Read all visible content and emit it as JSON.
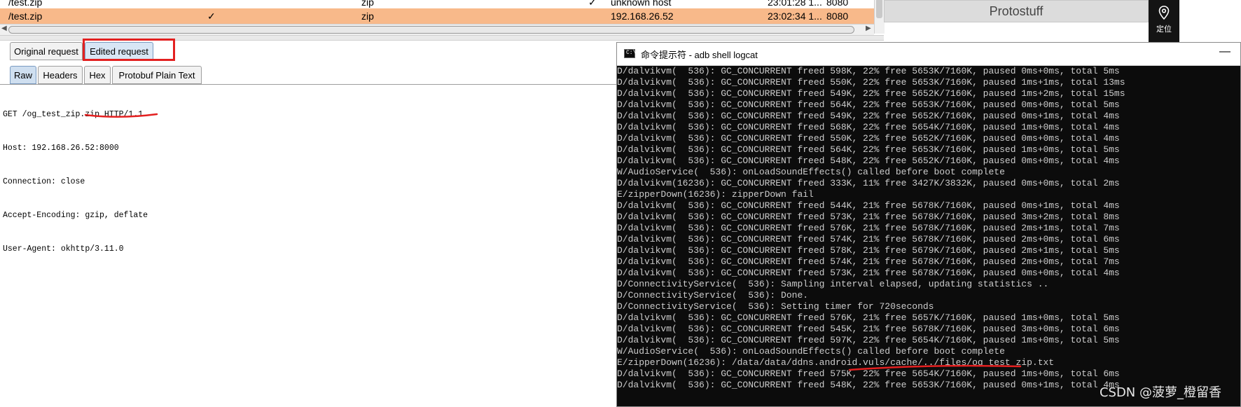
{
  "history": {
    "rows": [
      {
        "path": "/test.zip",
        "check": "",
        "ext": "zip",
        "edited": "✓",
        "ip": "unknown host",
        "time": "23:01:28 1...",
        "port": "8080"
      },
      {
        "path": "/test.zip",
        "check": "✓",
        "ext": "zip",
        "edited": "",
        "ip": "192.168.26.52",
        "time": "23:02:34 1...",
        "port": "8080"
      }
    ]
  },
  "request_tabs": {
    "original": "Original request",
    "edited": "Edited request"
  },
  "view_tabs": {
    "raw": "Raw",
    "headers": "Headers",
    "hex": "Hex",
    "protobuf": "Protobuf Plain Text"
  },
  "request_lines": [
    "GET /og_test_zip.zip HTTP/1.1",
    "Host: 192.168.26.52:8000",
    "Connection: close",
    "Accept-Encoding: gzip, deflate",
    "User-Agent: okhttp/3.11.0"
  ],
  "side_panel": {
    "protostuff_label": "Protostuff",
    "locate_label": "定位"
  },
  "cmd": {
    "title": "命令提示符 - adb  shell logcat",
    "icon_text": "C:\\",
    "minimize": "—",
    "lines": [
      "D/dalvikvm(  536): GC_CONCURRENT freed 598K, 22% free 5653K/7160K, paused 0ms+0ms, total 5ms",
      "D/dalvikvm(  536): GC_CONCURRENT freed 550K, 22% free 5653K/7160K, paused 1ms+1ms, total 13ms",
      "D/dalvikvm(  536): GC_CONCURRENT freed 549K, 22% free 5652K/7160K, paused 1ms+2ms, total 15ms",
      "D/dalvikvm(  536): GC_CONCURRENT freed 564K, 22% free 5653K/7160K, paused 0ms+0ms, total 5ms",
      "D/dalvikvm(  536): GC_CONCURRENT freed 549K, 22% free 5652K/7160K, paused 0ms+1ms, total 4ms",
      "D/dalvikvm(  536): GC_CONCURRENT freed 568K, 22% free 5654K/7160K, paused 1ms+0ms, total 4ms",
      "D/dalvikvm(  536): GC_CONCURRENT freed 550K, 22% free 5652K/7160K, paused 0ms+0ms, total 4ms",
      "D/dalvikvm(  536): GC_CONCURRENT freed 564K, 22% free 5653K/7160K, paused 1ms+0ms, total 5ms",
      "D/dalvikvm(  536): GC_CONCURRENT freed 548K, 22% free 5652K/7160K, paused 0ms+0ms, total 4ms",
      "W/AudioService(  536): onLoadSoundEffects() called before boot complete",
      "D/dalvikvm(16236): GC_CONCURRENT freed 333K, 11% free 3427K/3832K, paused 0ms+0ms, total 2ms",
      "E/zipperDown(16236): zipperDown fail",
      "D/dalvikvm(  536): GC_CONCURRENT freed 544K, 21% free 5678K/7160K, paused 0ms+1ms, total 4ms",
      "D/dalvikvm(  536): GC_CONCURRENT freed 573K, 21% free 5678K/7160K, paused 3ms+2ms, total 8ms",
      "D/dalvikvm(  536): GC_CONCURRENT freed 576K, 21% free 5678K/7160K, paused 2ms+1ms, total 7ms",
      "D/dalvikvm(  536): GC_CONCURRENT freed 574K, 21% free 5678K/7160K, paused 2ms+0ms, total 6ms",
      "D/dalvikvm(  536): GC_CONCURRENT freed 578K, 21% free 5679K/7160K, paused 2ms+1ms, total 5ms",
      "D/dalvikvm(  536): GC_CONCURRENT freed 574K, 21% free 5678K/7160K, paused 2ms+0ms, total 7ms",
      "D/dalvikvm(  536): GC_CONCURRENT freed 573K, 21% free 5678K/7160K, paused 0ms+0ms, total 4ms",
      "D/ConnectivityService(  536): Sampling interval elapsed, updating statistics ..",
      "D/ConnectivityService(  536): Done.",
      "D/ConnectivityService(  536): Setting timer for 720seconds",
      "D/dalvikvm(  536): GC_CONCURRENT freed 576K, 21% free 5657K/7160K, paused 1ms+0ms, total 5ms",
      "D/dalvikvm(  536): GC_CONCURRENT freed 545K, 21% free 5678K/7160K, paused 3ms+0ms, total 6ms",
      "D/dalvikvm(  536): GC_CONCURRENT freed 597K, 22% free 5654K/7160K, paused 1ms+0ms, total 5ms",
      "W/AudioService(  536): onLoadSoundEffects() called before boot complete",
      "E/zipperDown(16236): /data/data/ddns.android.vuls/cache/../files/og_test_zip.txt",
      "D/dalvikvm(  536): GC_CONCURRENT freed 575K, 22% free 5654K/7160K, paused 1ms+0ms, total 6ms",
      "D/dalvikvm(  536): GC_CONCURRENT freed 548K, 22% free 5653K/7160K, paused 0ms+1ms, total 4ms"
    ]
  },
  "watermark": "CSDN @菠萝_橙留香",
  "colors": {
    "selected_row": "#f8b98a",
    "highlight": "#e32020",
    "terminal_bg": "#0c0c0c",
    "terminal_fg": "#cccccc"
  }
}
